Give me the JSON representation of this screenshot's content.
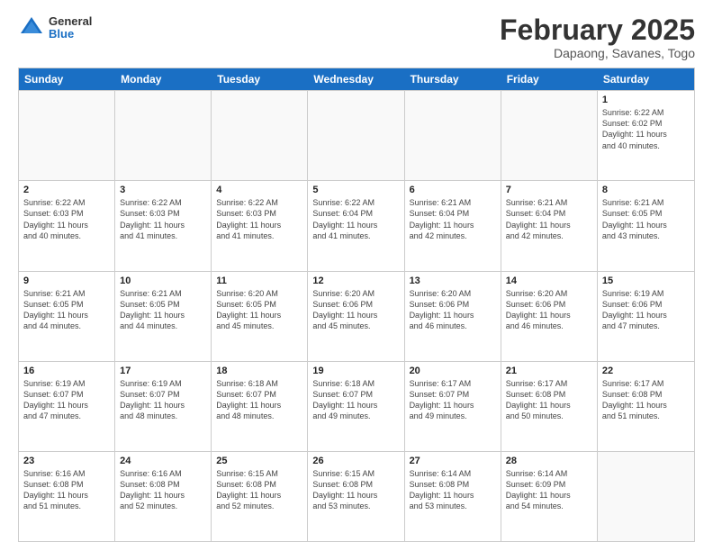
{
  "logo": {
    "general": "General",
    "blue": "Blue"
  },
  "header": {
    "month": "February 2025",
    "location": "Dapaong, Savanes, Togo"
  },
  "days_of_week": [
    "Sunday",
    "Monday",
    "Tuesday",
    "Wednesday",
    "Thursday",
    "Friday",
    "Saturday"
  ],
  "weeks": [
    [
      {
        "day": "",
        "info": ""
      },
      {
        "day": "",
        "info": ""
      },
      {
        "day": "",
        "info": ""
      },
      {
        "day": "",
        "info": ""
      },
      {
        "day": "",
        "info": ""
      },
      {
        "day": "",
        "info": ""
      },
      {
        "day": "1",
        "info": "Sunrise: 6:22 AM\nSunset: 6:02 PM\nDaylight: 11 hours\nand 40 minutes."
      }
    ],
    [
      {
        "day": "2",
        "info": "Sunrise: 6:22 AM\nSunset: 6:03 PM\nDaylight: 11 hours\nand 40 minutes."
      },
      {
        "day": "3",
        "info": "Sunrise: 6:22 AM\nSunset: 6:03 PM\nDaylight: 11 hours\nand 41 minutes."
      },
      {
        "day": "4",
        "info": "Sunrise: 6:22 AM\nSunset: 6:03 PM\nDaylight: 11 hours\nand 41 minutes."
      },
      {
        "day": "5",
        "info": "Sunrise: 6:22 AM\nSunset: 6:04 PM\nDaylight: 11 hours\nand 41 minutes."
      },
      {
        "day": "6",
        "info": "Sunrise: 6:21 AM\nSunset: 6:04 PM\nDaylight: 11 hours\nand 42 minutes."
      },
      {
        "day": "7",
        "info": "Sunrise: 6:21 AM\nSunset: 6:04 PM\nDaylight: 11 hours\nand 42 minutes."
      },
      {
        "day": "8",
        "info": "Sunrise: 6:21 AM\nSunset: 6:05 PM\nDaylight: 11 hours\nand 43 minutes."
      }
    ],
    [
      {
        "day": "9",
        "info": "Sunrise: 6:21 AM\nSunset: 6:05 PM\nDaylight: 11 hours\nand 44 minutes."
      },
      {
        "day": "10",
        "info": "Sunrise: 6:21 AM\nSunset: 6:05 PM\nDaylight: 11 hours\nand 44 minutes."
      },
      {
        "day": "11",
        "info": "Sunrise: 6:20 AM\nSunset: 6:05 PM\nDaylight: 11 hours\nand 45 minutes."
      },
      {
        "day": "12",
        "info": "Sunrise: 6:20 AM\nSunset: 6:06 PM\nDaylight: 11 hours\nand 45 minutes."
      },
      {
        "day": "13",
        "info": "Sunrise: 6:20 AM\nSunset: 6:06 PM\nDaylight: 11 hours\nand 46 minutes."
      },
      {
        "day": "14",
        "info": "Sunrise: 6:20 AM\nSunset: 6:06 PM\nDaylight: 11 hours\nand 46 minutes."
      },
      {
        "day": "15",
        "info": "Sunrise: 6:19 AM\nSunset: 6:06 PM\nDaylight: 11 hours\nand 47 minutes."
      }
    ],
    [
      {
        "day": "16",
        "info": "Sunrise: 6:19 AM\nSunset: 6:07 PM\nDaylight: 11 hours\nand 47 minutes."
      },
      {
        "day": "17",
        "info": "Sunrise: 6:19 AM\nSunset: 6:07 PM\nDaylight: 11 hours\nand 48 minutes."
      },
      {
        "day": "18",
        "info": "Sunrise: 6:18 AM\nSunset: 6:07 PM\nDaylight: 11 hours\nand 48 minutes."
      },
      {
        "day": "19",
        "info": "Sunrise: 6:18 AM\nSunset: 6:07 PM\nDaylight: 11 hours\nand 49 minutes."
      },
      {
        "day": "20",
        "info": "Sunrise: 6:17 AM\nSunset: 6:07 PM\nDaylight: 11 hours\nand 49 minutes."
      },
      {
        "day": "21",
        "info": "Sunrise: 6:17 AM\nSunset: 6:08 PM\nDaylight: 11 hours\nand 50 minutes."
      },
      {
        "day": "22",
        "info": "Sunrise: 6:17 AM\nSunset: 6:08 PM\nDaylight: 11 hours\nand 51 minutes."
      }
    ],
    [
      {
        "day": "23",
        "info": "Sunrise: 6:16 AM\nSunset: 6:08 PM\nDaylight: 11 hours\nand 51 minutes."
      },
      {
        "day": "24",
        "info": "Sunrise: 6:16 AM\nSunset: 6:08 PM\nDaylight: 11 hours\nand 52 minutes."
      },
      {
        "day": "25",
        "info": "Sunrise: 6:15 AM\nSunset: 6:08 PM\nDaylight: 11 hours\nand 52 minutes."
      },
      {
        "day": "26",
        "info": "Sunrise: 6:15 AM\nSunset: 6:08 PM\nDaylight: 11 hours\nand 53 minutes."
      },
      {
        "day": "27",
        "info": "Sunrise: 6:14 AM\nSunset: 6:08 PM\nDaylight: 11 hours\nand 53 minutes."
      },
      {
        "day": "28",
        "info": "Sunrise: 6:14 AM\nSunset: 6:09 PM\nDaylight: 11 hours\nand 54 minutes."
      },
      {
        "day": "",
        "info": ""
      }
    ]
  ]
}
